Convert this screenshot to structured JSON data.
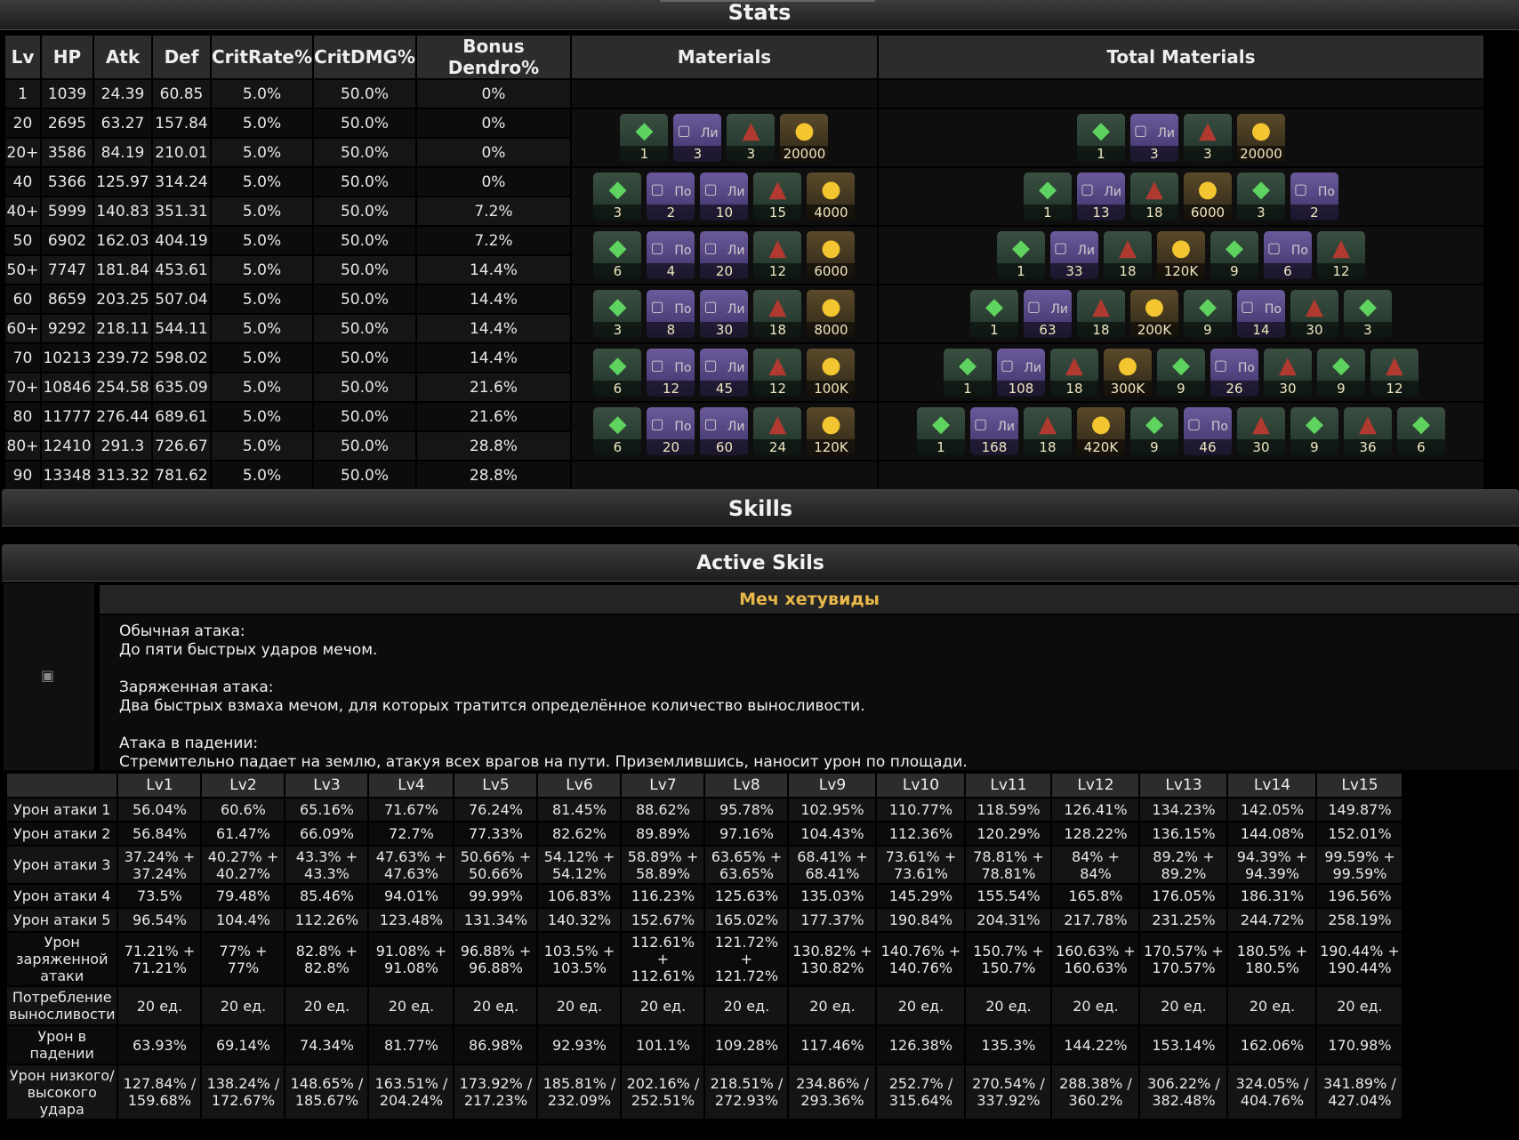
{
  "sections": {
    "stats": "Stats",
    "skills": "Skills",
    "active": "Active Skils"
  },
  "stats": {
    "headers": [
      "Lv",
      "HP",
      "Atk",
      "Def",
      "CritRate%",
      "CritDMG%",
      "Bonus Dendro%",
      "Materials",
      "Total Materials"
    ],
    "rows": [
      [
        "1",
        "1039",
        "24.39",
        "60.85",
        "5.0%",
        "50.0%",
        "0%"
      ],
      [
        "20",
        "2695",
        "63.27",
        "157.84",
        "5.0%",
        "50.0%",
        "0%"
      ],
      [
        "20+",
        "3586",
        "84.19",
        "210.01",
        "5.0%",
        "50.0%",
        "0%"
      ],
      [
        "40",
        "5366",
        "125.97",
        "314.24",
        "5.0%",
        "50.0%",
        "0%"
      ],
      [
        "40+",
        "5999",
        "140.83",
        "351.31",
        "5.0%",
        "50.0%",
        "7.2%"
      ],
      [
        "50",
        "6902",
        "162.03",
        "404.19",
        "5.0%",
        "50.0%",
        "7.2%"
      ],
      [
        "50+",
        "7747",
        "181.84",
        "453.61",
        "5.0%",
        "50.0%",
        "14.4%"
      ],
      [
        "60",
        "8659",
        "203.25",
        "507.04",
        "5.0%",
        "50.0%",
        "14.4%"
      ],
      [
        "60+",
        "9292",
        "218.11",
        "544.11",
        "5.0%",
        "50.0%",
        "14.4%"
      ],
      [
        "70",
        "10213",
        "239.72",
        "598.02",
        "5.0%",
        "50.0%",
        "14.4%"
      ],
      [
        "70+",
        "10846",
        "254.58",
        "635.09",
        "5.0%",
        "50.0%",
        "21.6%"
      ],
      [
        "80",
        "11777",
        "276.44",
        "689.61",
        "5.0%",
        "50.0%",
        "21.6%"
      ],
      [
        "80+",
        "12410",
        "291.3",
        "726.67",
        "5.0%",
        "50.0%",
        "28.8%"
      ],
      [
        "90",
        "13348",
        "313.32",
        "781.62",
        "5.0%",
        "50.0%",
        "28.8%"
      ]
    ],
    "materials": [
      [
        {
          "k": "g",
          "c": "1"
        },
        {
          "k": "p",
          "t": "Ли",
          "c": "3"
        },
        {
          "k": "m",
          "c": "3"
        },
        {
          "k": "coin",
          "c": "20000"
        }
      ],
      [
        {
          "k": "g",
          "c": "3"
        },
        {
          "k": "p",
          "t": "По",
          "c": "2"
        },
        {
          "k": "p",
          "t": "Ли",
          "c": "10"
        },
        {
          "k": "m",
          "c": "15"
        },
        {
          "k": "coin",
          "c": "4000"
        }
      ],
      [
        {
          "k": "g",
          "c": "6"
        },
        {
          "k": "p",
          "t": "По",
          "c": "4"
        },
        {
          "k": "p",
          "t": "Ли",
          "c": "20"
        },
        {
          "k": "m",
          "c": "12"
        },
        {
          "k": "coin",
          "c": "6000"
        }
      ],
      [
        {
          "k": "g",
          "c": "3"
        },
        {
          "k": "p",
          "t": "По",
          "c": "8"
        },
        {
          "k": "p",
          "t": "Ли",
          "c": "30"
        },
        {
          "k": "m",
          "c": "18"
        },
        {
          "k": "coin",
          "c": "8000"
        }
      ],
      [
        {
          "k": "g",
          "c": "6"
        },
        {
          "k": "p",
          "t": "По",
          "c": "12"
        },
        {
          "k": "p",
          "t": "Ли",
          "c": "45"
        },
        {
          "k": "m",
          "c": "12"
        },
        {
          "k": "coin",
          "c": "100K"
        }
      ],
      [
        {
          "k": "g",
          "c": "6"
        },
        {
          "k": "p",
          "t": "По",
          "c": "20"
        },
        {
          "k": "p",
          "t": "Ли",
          "c": "60"
        },
        {
          "k": "m",
          "c": "24"
        },
        {
          "k": "coin",
          "c": "120K"
        }
      ]
    ],
    "total_materials": [
      [
        {
          "k": "g",
          "c": "1"
        },
        {
          "k": "p",
          "t": "Ли",
          "c": "3"
        },
        {
          "k": "m",
          "c": "3"
        },
        {
          "k": "coin",
          "c": "20000"
        }
      ],
      [
        {
          "k": "g",
          "c": "1"
        },
        {
          "k": "p",
          "t": "Ли",
          "c": "13"
        },
        {
          "k": "m",
          "c": "18"
        },
        {
          "k": "coin",
          "c": "6000"
        },
        {
          "k": "g",
          "c": "3"
        },
        {
          "k": "p",
          "t": "По",
          "c": "2"
        }
      ],
      [
        {
          "k": "g",
          "c": "1"
        },
        {
          "k": "p",
          "t": "Ли",
          "c": "33"
        },
        {
          "k": "m",
          "c": "18"
        },
        {
          "k": "coin",
          "c": "120K"
        },
        {
          "k": "g",
          "c": "9"
        },
        {
          "k": "p",
          "t": "По",
          "c": "6"
        },
        {
          "k": "m",
          "c": "12"
        }
      ],
      [
        {
          "k": "g",
          "c": "1"
        },
        {
          "k": "p",
          "t": "Ли",
          "c": "63"
        },
        {
          "k": "m",
          "c": "18"
        },
        {
          "k": "coin",
          "c": "200K"
        },
        {
          "k": "g",
          "c": "9"
        },
        {
          "k": "p",
          "t": "По",
          "c": "14"
        },
        {
          "k": "m",
          "c": "30"
        },
        {
          "k": "g",
          "c": "3"
        }
      ],
      [
        {
          "k": "g",
          "c": "1"
        },
        {
          "k": "p",
          "t": "Ли",
          "c": "108"
        },
        {
          "k": "m",
          "c": "18"
        },
        {
          "k": "coin",
          "c": "300K"
        },
        {
          "k": "g",
          "c": "9"
        },
        {
          "k": "p",
          "t": "По",
          "c": "26"
        },
        {
          "k": "m",
          "c": "30"
        },
        {
          "k": "g",
          "c": "9"
        },
        {
          "k": "m",
          "c": "12"
        }
      ],
      [
        {
          "k": "g",
          "c": "1"
        },
        {
          "k": "p",
          "t": "Ли",
          "c": "168"
        },
        {
          "k": "m",
          "c": "18"
        },
        {
          "k": "coin",
          "c": "420K"
        },
        {
          "k": "g",
          "c": "9"
        },
        {
          "k": "p",
          "t": "По",
          "c": "46"
        },
        {
          "k": "m",
          "c": "30"
        },
        {
          "k": "g",
          "c": "9"
        },
        {
          "k": "m",
          "c": "36"
        },
        {
          "k": "g",
          "c": "6"
        }
      ]
    ]
  },
  "skill": {
    "name": "Меч хетувиды",
    "description": [
      [
        "Обычная атака:",
        "До пяти быстрых ударов мечом."
      ],
      [
        "Заряженная атака:",
        "Два быстрых взмаха мечом, для которых тратится определённое количество выносливости."
      ],
      [
        "Атака в падении:",
        "Стремительно падает на землю, атакуя всех врагов на пути. Приземлившись, наносит урон по площади."
      ]
    ],
    "levels": [
      "Lv1",
      "Lv2",
      "Lv3",
      "Lv4",
      "Lv5",
      "Lv6",
      "Lv7",
      "Lv8",
      "Lv9",
      "Lv10",
      "Lv11",
      "Lv12",
      "Lv13",
      "Lv14",
      "Lv15"
    ],
    "rows": [
      {
        "label": "Урон атаки 1",
        "values": [
          "56.04%",
          "60.6%",
          "65.16%",
          "71.67%",
          "76.24%",
          "81.45%",
          "88.62%",
          "95.78%",
          "102.95%",
          "110.77%",
          "118.59%",
          "126.41%",
          "134.23%",
          "142.05%",
          "149.87%"
        ]
      },
      {
        "label": "Урон атаки 2",
        "values": [
          "56.84%",
          "61.47%",
          "66.09%",
          "72.7%",
          "77.33%",
          "82.62%",
          "89.89%",
          "97.16%",
          "104.43%",
          "112.36%",
          "120.29%",
          "128.22%",
          "136.15%",
          "144.08%",
          "152.01%"
        ]
      },
      {
        "label": "Урон атаки 3",
        "values": [
          "37.24% + 37.24%",
          "40.27% + 40.27%",
          "43.3% + 43.3%",
          "47.63% + 47.63%",
          "50.66% + 50.66%",
          "54.12% + 54.12%",
          "58.89% + 58.89%",
          "63.65% + 63.65%",
          "68.41% + 68.41%",
          "73.61% + 73.61%",
          "78.81% + 78.81%",
          "84% + 84%",
          "89.2% + 89.2%",
          "94.39% + 94.39%",
          "99.59% + 99.59%"
        ]
      },
      {
        "label": "Урон атаки 4",
        "values": [
          "73.5%",
          "79.48%",
          "85.46%",
          "94.01%",
          "99.99%",
          "106.83%",
          "116.23%",
          "125.63%",
          "135.03%",
          "145.29%",
          "155.54%",
          "165.8%",
          "176.05%",
          "186.31%",
          "196.56%"
        ]
      },
      {
        "label": "Урон атаки 5",
        "values": [
          "96.54%",
          "104.4%",
          "112.26%",
          "123.48%",
          "131.34%",
          "140.32%",
          "152.67%",
          "165.02%",
          "177.37%",
          "190.84%",
          "204.31%",
          "217.78%",
          "231.25%",
          "244.72%",
          "258.19%"
        ]
      },
      {
        "label": "Урон заряженной атаки",
        "values": [
          "71.21% + 71.21%",
          "77% + 77%",
          "82.8% + 82.8%",
          "91.08% + 91.08%",
          "96.88% + 96.88%",
          "103.5% + 103.5%",
          "112.61% + 112.61%",
          "121.72% + 121.72%",
          "130.82% + 130.82%",
          "140.76% + 140.76%",
          "150.7% + 150.7%",
          "160.63% + 160.63%",
          "170.57% + 170.57%",
          "180.5% + 180.5%",
          "190.44% + 190.44%"
        ]
      },
      {
        "label": "Потребление выносливости",
        "values": [
          "20 ед.",
          "20 ед.",
          "20 ед.",
          "20 ед.",
          "20 ед.",
          "20 ед.",
          "20 ед.",
          "20 ед.",
          "20 ед.",
          "20 ед.",
          "20 ед.",
          "20 ед.",
          "20 ед.",
          "20 ед.",
          "20 ед."
        ]
      },
      {
        "label": "Урон в падении",
        "values": [
          "63.93%",
          "69.14%",
          "74.34%",
          "81.77%",
          "86.98%",
          "92.93%",
          "101.1%",
          "109.28%",
          "117.46%",
          "126.38%",
          "135.3%",
          "144.22%",
          "153.14%",
          "162.06%",
          "170.98%"
        ]
      },
      {
        "label": "Урон низкого/ высокого удара",
        "values": [
          "127.84% / 159.68%",
          "138.24% / 172.67%",
          "148.65% / 185.67%",
          "163.51% / 204.24%",
          "173.92% / 217.23%",
          "185.81% / 232.09%",
          "202.16% / 252.51%",
          "218.51% / 272.93%",
          "234.86% / 293.36%",
          "252.7% / 315.64%",
          "270.54% / 337.92%",
          "288.38% / 360.2%",
          "306.22% / 382.48%",
          "324.05% / 404.76%",
          "341.89% / 427.04%"
        ]
      }
    ]
  },
  "colors": {
    "accent": "#e8b84b",
    "header_bg": "#2c2c2c",
    "bg": "#000000"
  },
  "icons": {
    "g": "gem-icon",
    "p": "broken-image-icon",
    "m": "mask-material-icon",
    "coin": "mora-coin-icon"
  }
}
